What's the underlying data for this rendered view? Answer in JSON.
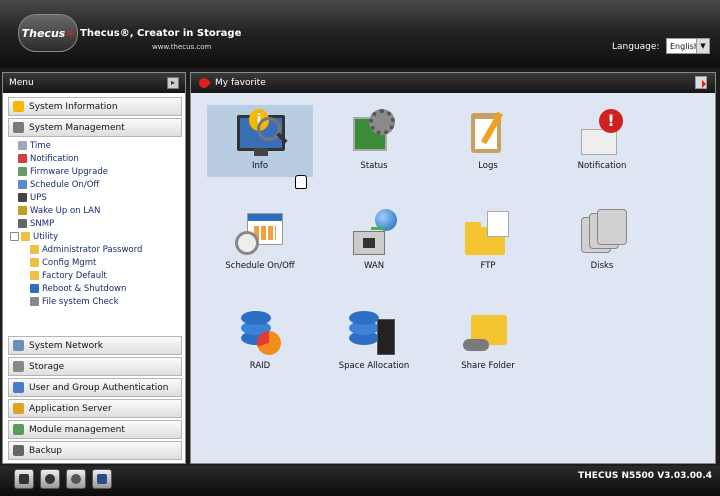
{
  "header": {
    "logo_text": "Thecus",
    "logo_reg": "®",
    "tagline": "Thecus®, Creator in Storage",
    "website": "www.thecus.com",
    "language_label": "Language:",
    "language_value": "English"
  },
  "menu": {
    "title": "Menu",
    "categories_top": [
      {
        "label": "System Information",
        "icon": "info-icon",
        "color": "#f5b800"
      },
      {
        "label": "System Management",
        "icon": "tools-icon",
        "color": "#7a7a7a"
      }
    ],
    "tree": [
      {
        "label": "Time",
        "icon": "clock-icon"
      },
      {
        "label": "Notification",
        "icon": "notification-icon"
      },
      {
        "label": "Firmware Upgrade",
        "icon": "firmware-icon"
      },
      {
        "label": "Schedule On/Off",
        "icon": "schedule-icon"
      },
      {
        "label": "UPS",
        "icon": "ups-icon"
      },
      {
        "label": "Wake Up on LAN",
        "icon": "wake-lan-icon"
      },
      {
        "label": "SNMP",
        "icon": "snmp-icon"
      },
      {
        "label": "Utility",
        "icon": "folder-icon"
      }
    ],
    "utility_children": [
      {
        "label": "Administrator Password",
        "icon": "key-icon"
      },
      {
        "label": "Config Mgmt",
        "icon": "config-icon"
      },
      {
        "label": "Factory Default",
        "icon": "factory-icon"
      },
      {
        "label": "Reboot & Shutdown",
        "icon": "power-icon"
      },
      {
        "label": "File system Check",
        "icon": "filecheck-icon"
      }
    ],
    "categories_bottom": [
      {
        "label": "System Network",
        "icon": "network-icon",
        "color": "#6a8fb8"
      },
      {
        "label": "Storage",
        "icon": "storage-icon",
        "color": "#888888"
      },
      {
        "label": "User and Group Authentication",
        "icon": "users-icon",
        "color": "#4a7ac8"
      },
      {
        "label": "Application Server",
        "icon": "app-server-icon",
        "color": "#e0a020"
      },
      {
        "label": "Module management",
        "icon": "module-icon",
        "color": "#5a9a5a"
      },
      {
        "label": "Backup",
        "icon": "backup-icon",
        "color": "#666666"
      }
    ]
  },
  "favorites": {
    "title": "My favorite",
    "tiles": [
      {
        "label": "Info",
        "icon": "info-monitor-icon"
      },
      {
        "label": "Status",
        "icon": "status-icon"
      },
      {
        "label": "Logs",
        "icon": "logs-icon"
      },
      {
        "label": "Notification",
        "icon": "notification-icon"
      },
      {
        "label": "Schedule On/Off",
        "icon": "schedule-icon"
      },
      {
        "label": "WAN",
        "icon": "wan-icon"
      },
      {
        "label": "FTP",
        "icon": "ftp-icon"
      },
      {
        "label": "Disks",
        "icon": "disks-icon"
      },
      {
        "label": "RAID",
        "icon": "raid-icon"
      },
      {
        "label": "Space Allocation",
        "icon": "space-allocation-icon"
      },
      {
        "label": "Share Folder",
        "icon": "share-folder-icon"
      }
    ]
  },
  "footer": {
    "version": "THECUS N5500 V3.03.00.4",
    "buttons": [
      "menu-bar-icon",
      "disc-icon",
      "refresh-icon",
      "network-map-icon"
    ]
  }
}
